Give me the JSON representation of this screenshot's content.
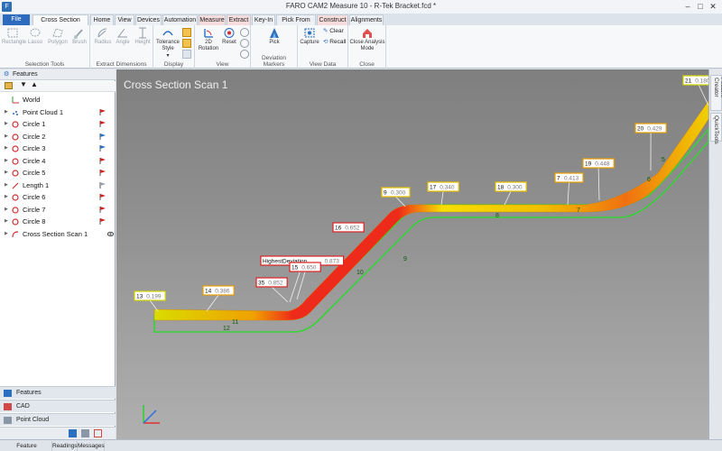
{
  "window": {
    "title": "FARO CAM2 Measure 10 - R-Tek Bracket.fcd *",
    "app_icon": "faro-logo-icon"
  },
  "ribbon_tabs": {
    "file": "File",
    "items": [
      "Cross Section Analysis",
      "Home",
      "View",
      "Devices",
      "Automation",
      "Measure",
      "Extract",
      "Key-In",
      "Pick From CAD",
      "Construct",
      "Alignments"
    ]
  },
  "ribbon": {
    "selection_tools": {
      "label": "Selection Tools",
      "buttons": [
        "Rectangle",
        "Lasso",
        "Polygon",
        "Brush"
      ]
    },
    "extract_dimensions": {
      "label": "Extract Dimensions",
      "buttons": [
        "Radius",
        "Angle",
        "Height"
      ]
    },
    "display": {
      "label": "Display",
      "buttons": [
        "Tolerance Style"
      ],
      "dropdown_glyph": "▾"
    },
    "view": {
      "label": "View",
      "buttons": [
        "2D Rotation",
        "Reset"
      ]
    },
    "deviation_markers": {
      "label": "Deviation Markers",
      "buttons": [
        "Pick"
      ]
    },
    "view_data": {
      "label": "View Data",
      "buttons": [
        "Capture",
        "Clear",
        "Recall"
      ]
    },
    "close": {
      "label": "Close",
      "buttons": [
        "Close Analysis Mode"
      ]
    }
  },
  "features_panel": {
    "header": "Features",
    "items": [
      {
        "label": "World",
        "icon": "world-axes-icon",
        "expander": false,
        "flag": false
      },
      {
        "label": "Point Cloud 1",
        "icon": "point-cloud-icon",
        "expander": true,
        "flag": true
      },
      {
        "label": "Circle 1",
        "icon": "circle-icon",
        "expander": true,
        "flag": true
      },
      {
        "label": "Circle 2",
        "icon": "circle-icon",
        "expander": true,
        "flag": true
      },
      {
        "label": "Circle 3",
        "icon": "circle-icon",
        "expander": true,
        "flag": true
      },
      {
        "label": "Circle 4",
        "icon": "circle-icon",
        "expander": true,
        "flag": true
      },
      {
        "label": "Circle 5",
        "icon": "circle-icon",
        "expander": true,
        "flag": true
      },
      {
        "label": "Length 1",
        "icon": "length-icon",
        "expander": true,
        "flag": true
      },
      {
        "label": "Circle 6",
        "icon": "circle-icon",
        "expander": true,
        "flag": true
      },
      {
        "label": "Circle 7",
        "icon": "circle-icon",
        "expander": true,
        "flag": true
      },
      {
        "label": "Circle 8",
        "icon": "circle-icon",
        "expander": true,
        "flag": true
      },
      {
        "label": "Cross Section Scan 1",
        "icon": "cross-section-icon",
        "expander": true,
        "flag": false
      }
    ]
  },
  "bottom_panes": [
    "Features",
    "CAD",
    "Point Cloud"
  ],
  "viewport": {
    "title": "Cross Section Scan 1",
    "deviation_labels": [
      {
        "id": "13",
        "value": "0.199",
        "color": "#d4d400"
      },
      {
        "id": "14",
        "value": "0.386",
        "color": "#e8a000"
      },
      {
        "id": "HighestDeviation",
        "value": "0.873",
        "color": "#dd2222"
      },
      {
        "id": "35",
        "value": "0.852",
        "color": "#dd2222"
      },
      {
        "id": "15",
        "value": "0.650",
        "color": "#dd2222"
      },
      {
        "id": "16",
        "value": "0.652",
        "color": "#dd2222"
      },
      {
        "id": "9",
        "value": "0.300",
        "color": "#e8c000"
      },
      {
        "id": "17",
        "value": "0.340",
        "color": "#e8c000"
      },
      {
        "id": "18",
        "value": "0.300",
        "color": "#e8c000"
      },
      {
        "id": "7",
        "value": "0.413",
        "color": "#e8a000"
      },
      {
        "id": "19",
        "value": "0.448",
        "color": "#e8a000"
      },
      {
        "id": "20",
        "value": "0.429",
        "color": "#e8a000"
      },
      {
        "id": "21",
        "value": "0.180",
        "color": "#d4d400"
      }
    ],
    "segment_numbers": [
      "12",
      "11",
      "10",
      "9",
      "8",
      "7",
      "6",
      "5"
    ]
  },
  "right_tabs": [
    "Feature Creator",
    "QuickTools"
  ],
  "status_tabs": [
    "Feature Information",
    "Readings",
    "Messages"
  ]
}
